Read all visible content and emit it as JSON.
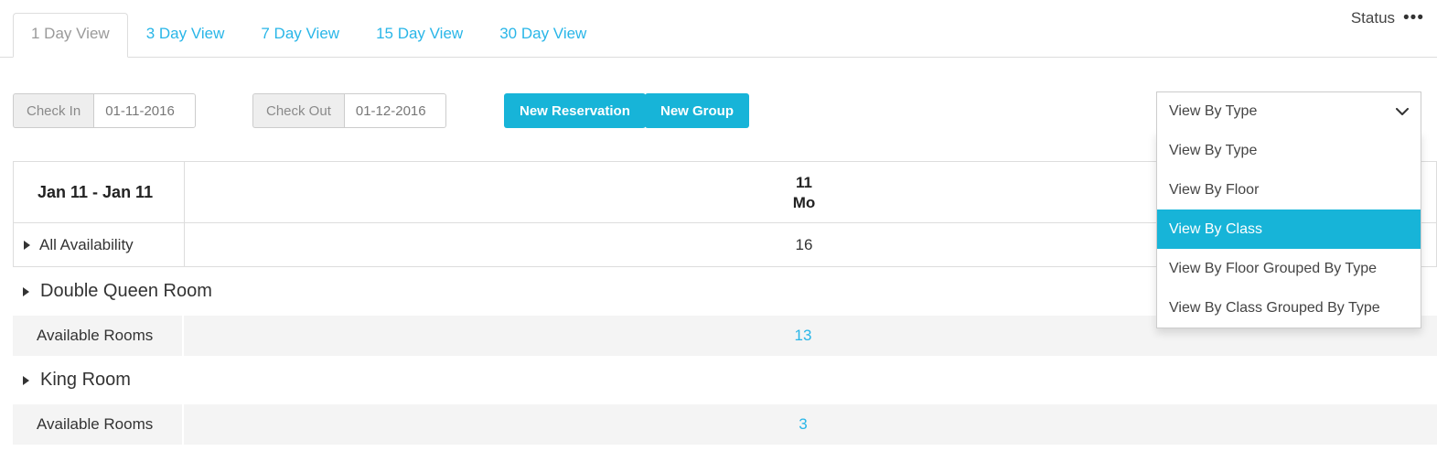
{
  "tabs": [
    {
      "label": "1 Day View",
      "active": true
    },
    {
      "label": "3 Day View",
      "active": false
    },
    {
      "label": "7 Day View",
      "active": false
    },
    {
      "label": "15 Day View",
      "active": false
    },
    {
      "label": "30 Day View",
      "active": false
    }
  ],
  "status": {
    "label": "Status",
    "dots": "•••"
  },
  "toolbar": {
    "check_in_label": "Check In",
    "check_in_value": "01-11-2016",
    "check_out_label": "Check Out",
    "check_out_value": "01-12-2016",
    "new_reservation_label": "New Reservation",
    "new_group_label": "New Group"
  },
  "view_dropdown": {
    "selected": "View By Type",
    "chevron": "⌄",
    "options": [
      {
        "label": "View By Type",
        "selected": false
      },
      {
        "label": "View By Floor",
        "selected": false
      },
      {
        "label": "View By Class",
        "selected": true
      },
      {
        "label": "View By Floor Grouped By Type",
        "selected": false
      },
      {
        "label": "View By Class Grouped By Type",
        "selected": false
      }
    ]
  },
  "grid": {
    "date_range": "Jan 11 - Jan 11",
    "day_columns": [
      {
        "number": "11",
        "weekday": "Mo"
      }
    ],
    "all_availability": {
      "label": "All Availability",
      "values": [
        "16"
      ]
    },
    "groups": [
      {
        "name": "Double Queen Room",
        "rows": [
          {
            "label": "Available Rooms",
            "values": [
              "13"
            ],
            "is_link": true
          }
        ]
      },
      {
        "name": "King Room",
        "rows": [
          {
            "label": "Available Rooms",
            "values": [
              "3"
            ],
            "is_link": true
          }
        ]
      }
    ]
  },
  "colors": {
    "accent": "#17b4d8",
    "link": "#29b6e8",
    "border": "#dddddd",
    "row_alt": "#f4f4f4"
  }
}
